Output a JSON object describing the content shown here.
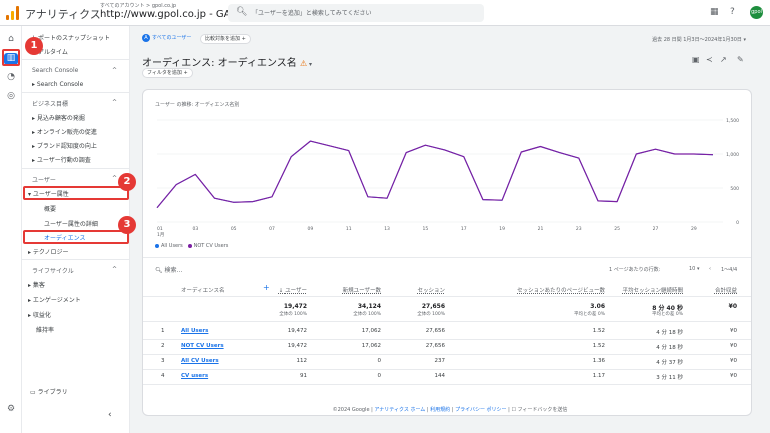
{
  "app": {
    "name": "アナリティクス",
    "breadcrumb": "すべてのアカウント > gpol.co.jp",
    "property": "http://www.gpol.co.jp - GA4",
    "search_placeholder": "「ユーザーを追加」と検索してみてください",
    "avatar_text": "gpol"
  },
  "sidebar": {
    "snapshot": "レポートのスナップショット",
    "realtime": "リアルタイム",
    "search_console_section": "Search Console",
    "search_console_item": "Search Console",
    "business_section": "ビジネス目標",
    "business_items": [
      "見込み顧客の発掘",
      "オンライン販売の促進",
      "ブランド認知度の向上",
      "ユーザー行動の調査"
    ],
    "user_section": "ユーザー",
    "user_attr": "ユーザー属性",
    "overview": "概要",
    "attr_detail": "ユーザー属性の詳細",
    "audience": "オーディエンス",
    "technology": "テクノロジー",
    "lifecycle_section": "ライフサイクル",
    "lifecycle_items": [
      "集客",
      "エンゲージメント",
      "収益化",
      "維持率"
    ],
    "library": "ライブラリ"
  },
  "badges": [
    "1",
    "2",
    "3"
  ],
  "header": {
    "all_users_chip": "すべてのユーザー",
    "compare_chip": "比較対象を追加",
    "date_range": "過去 28 日間  1月3日～2024年1月30日",
    "title": "オーディエンス: オーディエンス名",
    "add_filter": "フィルタを追加"
  },
  "chart_data": {
    "type": "line",
    "title": "ユーザー の推移: オーディエンス名別",
    "x": [
      "01",
      "02",
      "03",
      "04",
      "05",
      "06",
      "07",
      "08",
      "09",
      "10",
      "11",
      "12",
      "13",
      "14",
      "15",
      "16",
      "17",
      "18",
      "19",
      "20",
      "21",
      "22",
      "23",
      "24",
      "25",
      "26",
      "27",
      "28",
      "29",
      "30"
    ],
    "x_tick_labels": [
      "01 1月",
      "03",
      "05",
      "07",
      "09",
      "11",
      "13",
      "15",
      "17",
      "19",
      "21",
      "23",
      "25",
      "27",
      "29"
    ],
    "y_ticks": [
      "0",
      "500",
      "1,000",
      "1,500"
    ],
    "ylim": [
      0,
      1500
    ],
    "series": [
      {
        "name": "All Users",
        "color": "#1a73e8",
        "values": [
          210,
          550,
          700,
          350,
          290,
          300,
          370,
          960,
          1190,
          1120,
          1050,
          370,
          350,
          1020,
          1130,
          1060,
          960,
          330,
          320,
          1030,
          1110,
          1020,
          940,
          310,
          300,
          1000,
          1070,
          1000,
          1000,
          990
        ]
      },
      {
        "name": "NOT CV Users",
        "color": "#7b1fa2",
        "values": [
          210,
          550,
          700,
          350,
          290,
          300,
          370,
          960,
          1190,
          1120,
          1050,
          370,
          350,
          1020,
          1130,
          1060,
          960,
          330,
          320,
          1030,
          1110,
          1020,
          940,
          310,
          300,
          1000,
          1070,
          1000,
          1000,
          990
        ]
      }
    ]
  },
  "table": {
    "search_placeholder": "検索...",
    "rows_per_page_label": "1 ページあたりの行数:",
    "rows_per_page": "10",
    "pagination": "1～4/4",
    "headers": [
      "オーディエンス名",
      "ユーザー",
      "新規ユーザー数",
      "セッション",
      "セッションあたりのページビュー数",
      "平均セッション継続時間",
      "合計収益"
    ],
    "totals": [
      "19,472",
      "34,124",
      "27,656",
      "3.06",
      "8 分 40 秒",
      "¥0"
    ],
    "totals_sub": [
      "全体の 100%",
      "全体の 100%",
      "全体の 100%",
      "平均との差 0%",
      "平均との差 0%",
      ""
    ],
    "rows": [
      {
        "n": "1",
        "name": "All Users",
        "users": "19,472",
        "new_users": "17,062",
        "sessions": "27,656",
        "ppv": "1.52",
        "duration": "4 分 18 秒",
        "revenue": "¥0"
      },
      {
        "n": "2",
        "name": "NOT CV Users",
        "users": "19,472",
        "new_users": "17,062",
        "sessions": "27,656",
        "ppv": "1.52",
        "duration": "4 分 18 秒",
        "revenue": "¥0"
      },
      {
        "n": "3",
        "name": "All CV Users",
        "users": "112",
        "new_users": "0",
        "sessions": "237",
        "ppv": "1.36",
        "duration": "4 分 37 秒",
        "revenue": "¥0"
      },
      {
        "n": "4",
        "name": "CV users",
        "users": "91",
        "new_users": "0",
        "sessions": "144",
        "ppv": "1.17",
        "duration": "3 分 11 秒",
        "revenue": "¥0"
      }
    ]
  },
  "footer": {
    "copyright": "©2024 Google |",
    "links": [
      "アナリティクス ホーム",
      "利用規約",
      "プライバシー ポリシー"
    ],
    "feedback": "フィードバックを送信"
  }
}
